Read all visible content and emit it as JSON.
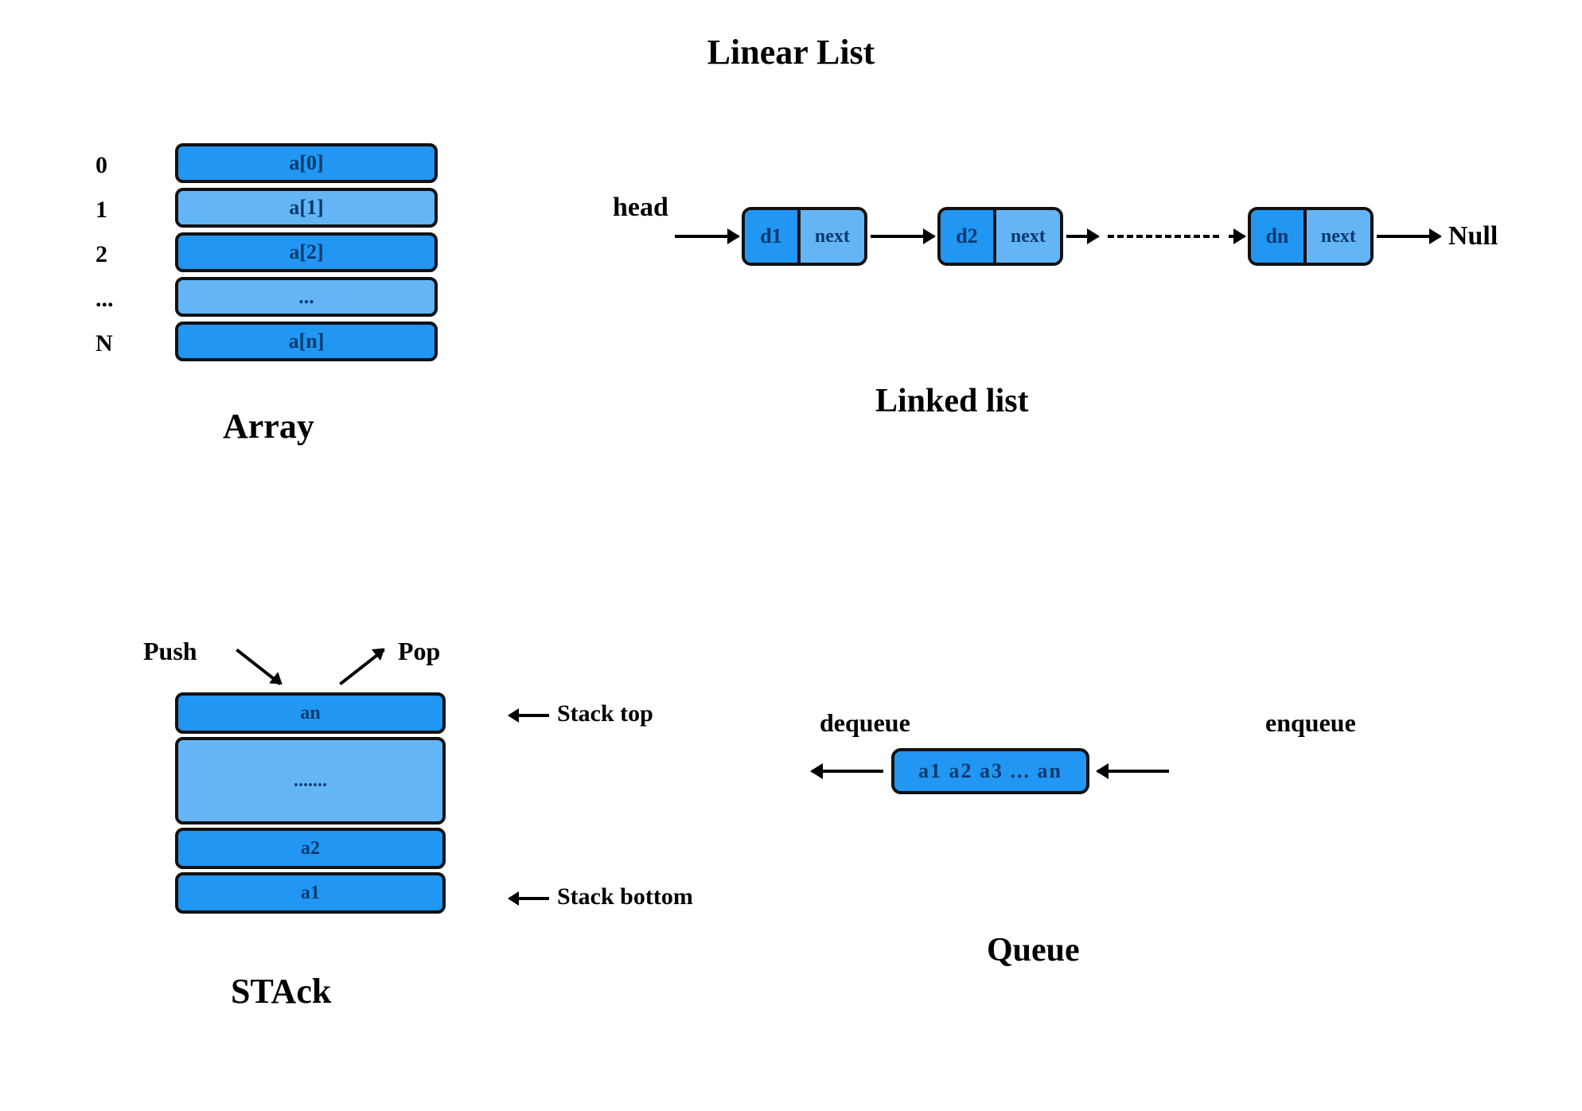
{
  "title": "Linear List",
  "array": {
    "label": "Array",
    "rows": [
      {
        "idx": "0",
        "val": "a[0]"
      },
      {
        "idx": "1",
        "val": "a[1]"
      },
      {
        "idx": "2",
        "val": "a[2]"
      },
      {
        "idx": "...",
        "val": "..."
      },
      {
        "idx": "N",
        "val": "a[n]"
      }
    ]
  },
  "linked_list": {
    "label": "Linked list",
    "head": "head",
    "null": "Null",
    "nodes": [
      {
        "data": "d1",
        "next": "next"
      },
      {
        "data": "d2",
        "next": "next"
      },
      {
        "data": "dn",
        "next": "next"
      }
    ]
  },
  "stack": {
    "label": "STAck",
    "push": "Push",
    "pop": "Pop",
    "top": "Stack top",
    "bottom": "Stack bottom",
    "cells": [
      "an",
      ".......",
      "a2",
      "a1"
    ]
  },
  "queue": {
    "label": "Queue",
    "dequeue": "dequeue",
    "enqueue": "enqueue",
    "content": "a1  a2  a3  ...  an"
  }
}
